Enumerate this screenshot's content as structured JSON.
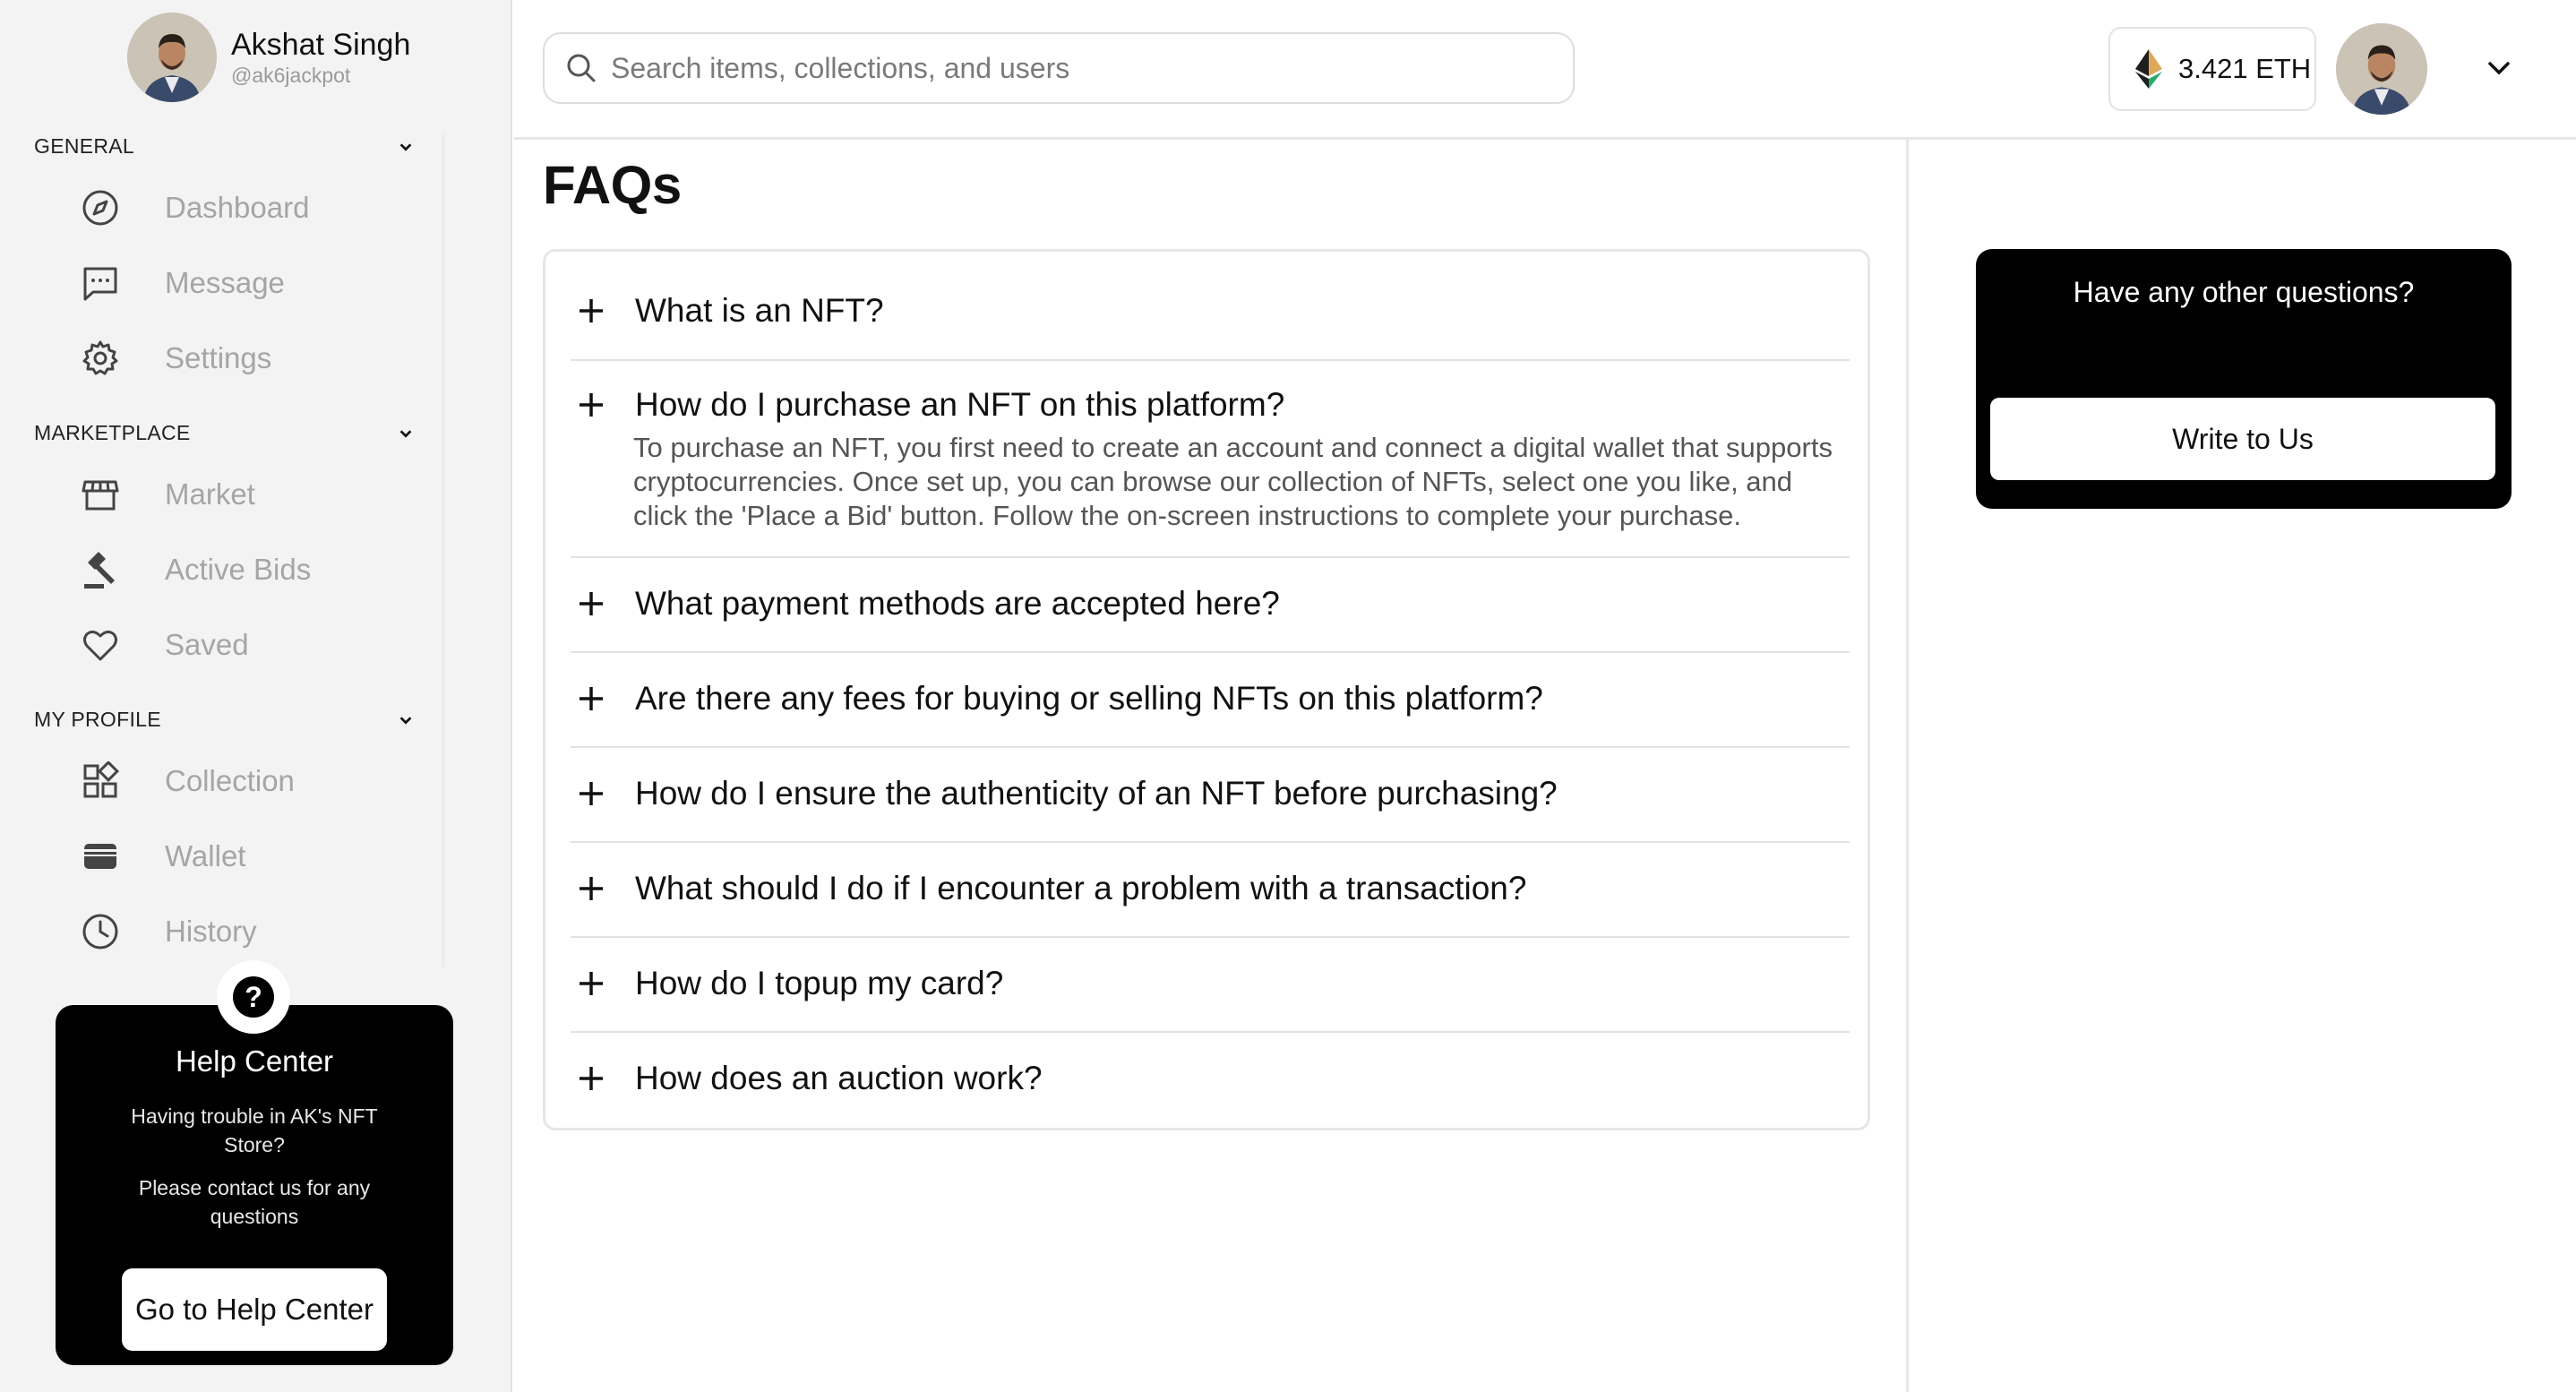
{
  "user": {
    "name": "Akshat Singh",
    "handle": "@ak6jackpot"
  },
  "sidebar": {
    "sections": [
      {
        "title": "GENERAL",
        "items": [
          {
            "label": "Dashboard",
            "icon": "compass-icon"
          },
          {
            "label": "Message",
            "icon": "message-icon"
          },
          {
            "label": "Settings",
            "icon": "gear-icon"
          }
        ]
      },
      {
        "title": "MARKETPLACE",
        "items": [
          {
            "label": "Market",
            "icon": "store-icon"
          },
          {
            "label": "Active Bids",
            "icon": "gavel-icon"
          },
          {
            "label": "Saved",
            "icon": "heart-icon"
          }
        ]
      },
      {
        "title": "MY PROFILE",
        "items": [
          {
            "label": "Collection",
            "icon": "grid-icon"
          },
          {
            "label": "Wallet",
            "icon": "wallet-icon"
          },
          {
            "label": "History",
            "icon": "clock-icon"
          }
        ]
      }
    ],
    "help": {
      "title": "Help Center",
      "text1": "Having trouble in AK's NFT Store?",
      "text2": "Please contact us for any questions",
      "button": "Go to Help Center"
    }
  },
  "search": {
    "placeholder": "Search items, collections, and users"
  },
  "wallet": {
    "balance": "3.421 ETH",
    "icon": "ethereum-icon"
  },
  "faq": {
    "title": "FAQs",
    "items": [
      {
        "question": "What is an NFT?"
      },
      {
        "question": "How do I purchase an NFT on this platform?",
        "answer": "To purchase an NFT, you first need to create an account and connect a digital wallet that supports cryptocurrencies. Once set up, you can browse our collection of NFTs, select one you like, and click the 'Place a Bid' button. Follow the on-screen instructions to complete your purchase."
      },
      {
        "question": "What payment methods are accepted here?"
      },
      {
        "question": "Are there any fees for buying or selling NFTs on this platform?"
      },
      {
        "question": "How do I ensure the authenticity of an NFT before purchasing?"
      },
      {
        "question": "What should I do if I encounter a problem with a transaction?"
      },
      {
        "question": "How do I topup my card?"
      },
      {
        "question": "How does an auction work?"
      }
    ]
  },
  "contact": {
    "title": "Have any other questions?",
    "button": "Write to Us"
  },
  "colors": {
    "accent": "#000000",
    "muted_text": "#a5a5a5",
    "sidebar_bg": "#f3f3f3"
  }
}
